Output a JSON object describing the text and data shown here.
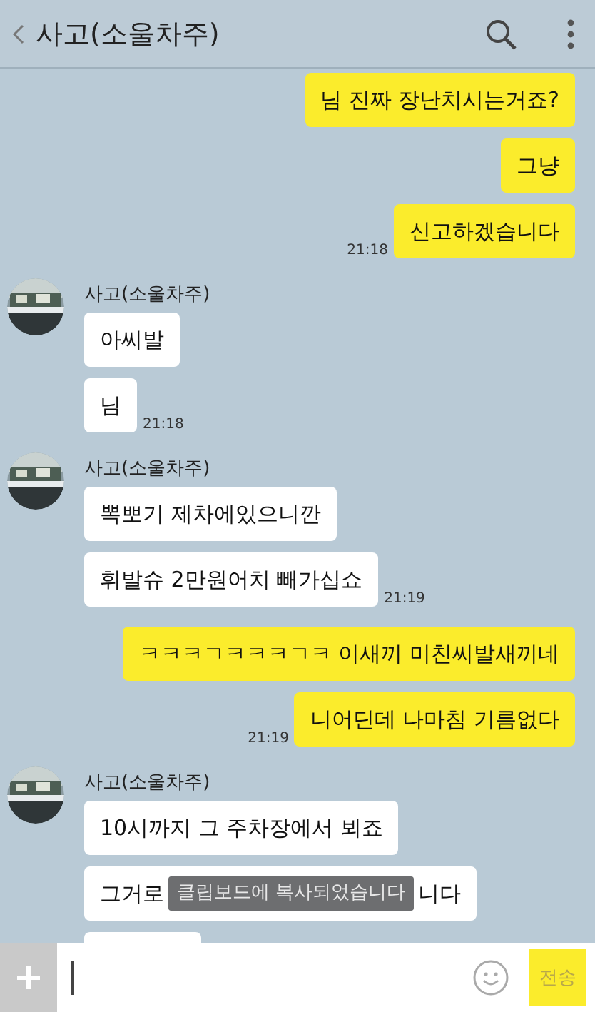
{
  "header": {
    "title": "사고(소울차주)"
  },
  "groups": [
    {
      "kind": "sent",
      "time": "21:18",
      "bubbles": [
        {
          "kind": "text",
          "text": "님 진짜 장난치시는거죠?"
        },
        {
          "kind": "text",
          "text": "그냥"
        },
        {
          "kind": "text",
          "text": "신고하겠습니다"
        }
      ]
    },
    {
      "kind": "received",
      "sender": "사고(소울차주)",
      "time": "21:18",
      "bubbles": [
        {
          "kind": "text",
          "text": "아씨발"
        },
        {
          "kind": "text",
          "text": "님"
        }
      ]
    },
    {
      "kind": "received",
      "sender": "사고(소울차주)",
      "time": "21:19",
      "bubbles": [
        {
          "kind": "text",
          "text": "뽁뽀기 제차에있으니깐"
        },
        {
          "kind": "text",
          "text": "휘발슈 2만원어치 빼가십쇼"
        }
      ]
    },
    {
      "kind": "sent",
      "time": "21:19",
      "bubbles": [
        {
          "kind": "text",
          "text": "ㅋㅋㅋㄱㅋㅋㅋㄱㅋ 이새끼 미친씨발새끼네"
        },
        {
          "kind": "text",
          "text": "니어딘데 나마침 기름없다"
        }
      ]
    },
    {
      "kind": "received",
      "sender": "사고(소울차주)",
      "bubbles": [
        {
          "kind": "text",
          "text": "10시까지 그 주차장에서 뵈죠"
        },
        {
          "kind": "covered",
          "start": "그거로",
          "end": "니다",
          "toast": "클립보드에 복사되었습니다"
        },
        {
          "kind": "cut"
        }
      ]
    }
  ],
  "composer": {
    "send": "전송"
  }
}
